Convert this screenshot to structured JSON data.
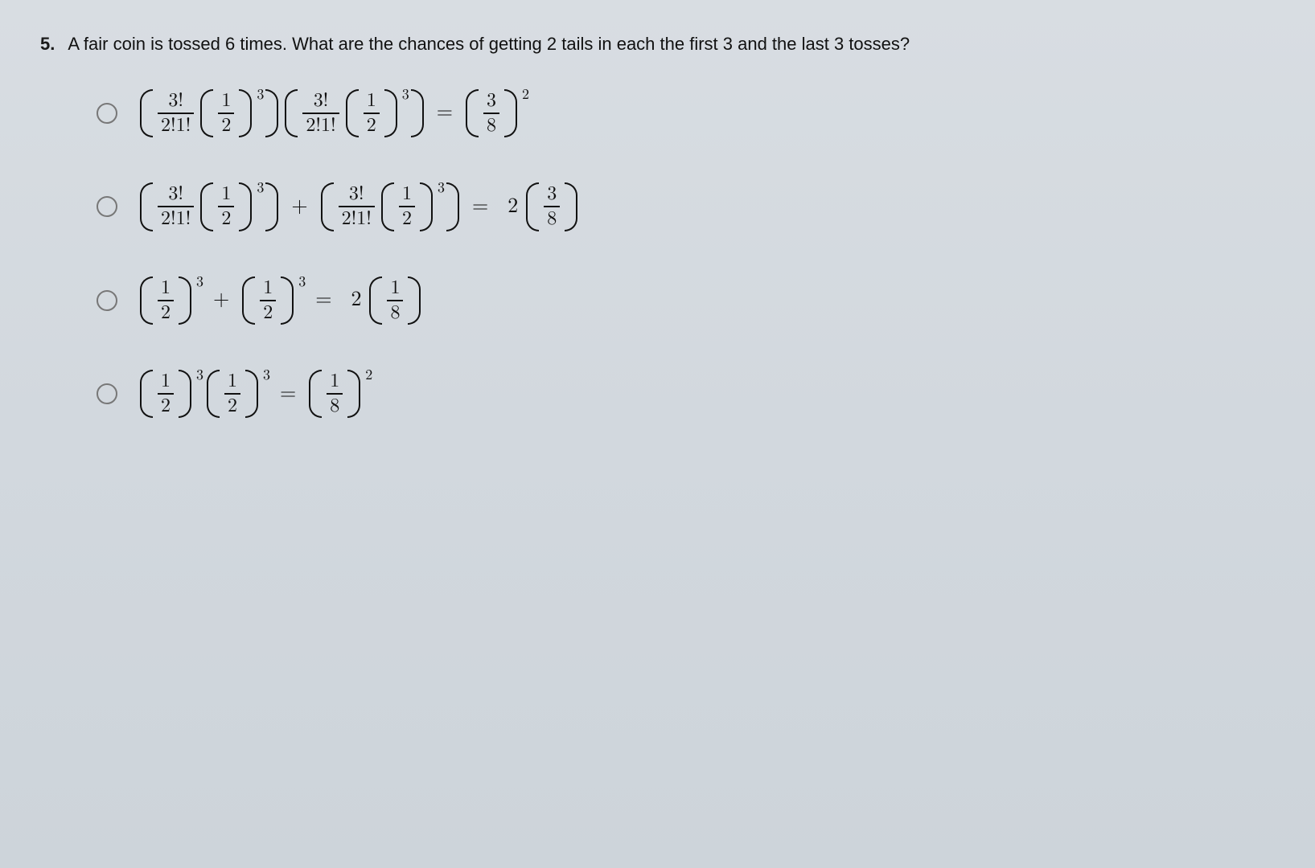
{
  "question": {
    "number": "5.",
    "text": "A fair coin is tossed 6 times. What are the chances of getting 2 tails in each the first 3 and the last 3 tosses?"
  },
  "ops": {
    "plus": "+",
    "eq": "="
  },
  "frac_3f_211f": {
    "num": "3!",
    "den": "2!1!"
  },
  "frac_1_2": {
    "num": "1",
    "den": "2"
  },
  "frac_3_8": {
    "num": "3",
    "den": "8"
  },
  "frac_1_8": {
    "num": "1",
    "den": "8"
  },
  "exp": {
    "three": "3",
    "two": "2"
  },
  "coef_2": "2"
}
